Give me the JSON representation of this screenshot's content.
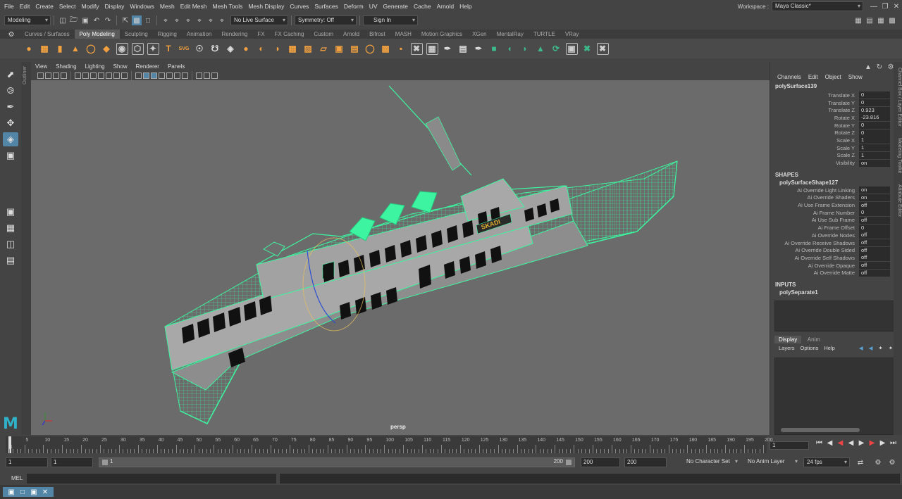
{
  "menubar": {
    "items": [
      "File",
      "Edit",
      "Create",
      "Select",
      "Modify",
      "Display",
      "Windows",
      "Mesh",
      "Edit Mesh",
      "Mesh Tools",
      "Mesh Display",
      "Curves",
      "Surfaces",
      "Deform",
      "UV",
      "Generate",
      "Cache",
      "Arnold",
      "Help"
    ],
    "workspace_label": "Workspace :",
    "workspace_value": "Maya Classic*"
  },
  "statusline": {
    "menuset": "Modeling",
    "live_surface": "No Live Surface",
    "symmetry": "Symmetry: Off",
    "sign_in": "Sign In"
  },
  "shelf": {
    "tabs": [
      "Curves / Surfaces",
      "Poly Modeling",
      "Sculpting",
      "Rigging",
      "Animation",
      "Rendering",
      "FX",
      "FX Caching",
      "Custom",
      "Arnold",
      "Bifrost",
      "MASH",
      "Motion Graphics",
      "XGen",
      "MentalRay",
      "TURTLE",
      "VRay"
    ],
    "active_tab": "Poly Modeling"
  },
  "sidebar_labels": {
    "outliner": "Outliner",
    "channel_box": "Channel Box / Layer Editor",
    "modeling_toolkit": "Modeling Toolkit",
    "attribute_editor": "Attribute Editor"
  },
  "viewport": {
    "menus": [
      "View",
      "Shading",
      "Lighting",
      "Show",
      "Renderer",
      "Panels"
    ],
    "camera_label": "persp",
    "logo_text": "M",
    "boat_name": "SKADI"
  },
  "channel_box": {
    "menus": [
      "Channels",
      "Edit",
      "Object",
      "Show"
    ],
    "object_name": "polySurface139",
    "attributes": [
      {
        "name": "Translate X",
        "value": "0"
      },
      {
        "name": "Translate Y",
        "value": "0"
      },
      {
        "name": "Translate Z",
        "value": "0.923"
      },
      {
        "name": "Rotate X",
        "value": "-23.816"
      },
      {
        "name": "Rotate Y",
        "value": "0"
      },
      {
        "name": "Rotate Z",
        "value": "0"
      },
      {
        "name": "Scale X",
        "value": "1"
      },
      {
        "name": "Scale Y",
        "value": "1"
      },
      {
        "name": "Scale Z",
        "value": "1"
      },
      {
        "name": "Visibility",
        "value": "on"
      }
    ],
    "shapes_header": "SHAPES",
    "shape_name": "polySurfaceShape127",
    "shape_attributes": [
      {
        "name": "Ai Override Light Linking",
        "value": "on"
      },
      {
        "name": "Ai Override Shaders",
        "value": "on"
      },
      {
        "name": "Ai Use Frame Extension",
        "value": "off"
      },
      {
        "name": "Ai Frame Number",
        "value": "0"
      },
      {
        "name": "Ai Use Sub Frame",
        "value": "off"
      },
      {
        "name": "Ai Frame Offset",
        "value": "0"
      },
      {
        "name": "Ai Override Nodes",
        "value": "off"
      },
      {
        "name": "Ai Override Receive Shadows",
        "value": "off"
      },
      {
        "name": "Ai Override Double Sided",
        "value": "off"
      },
      {
        "name": "Ai Override Self Shadows",
        "value": "off"
      },
      {
        "name": "Ai Override Opaque",
        "value": "off"
      },
      {
        "name": "Ai Override Matte",
        "value": "off"
      }
    ],
    "inputs_header": "INPUTS",
    "input_name": "polySeparate1"
  },
  "layer_editor": {
    "tabs": [
      "Display",
      "Anim"
    ],
    "active_tab": "Display",
    "menus": [
      "Layers",
      "Options",
      "Help"
    ]
  },
  "timeline": {
    "ticks": [
      "5",
      "10",
      "15",
      "20",
      "25",
      "30",
      "35",
      "40",
      "45",
      "50",
      "55",
      "60",
      "65",
      "70",
      "75",
      "80",
      "85",
      "90",
      "95",
      "100",
      "105",
      "110",
      "115",
      "120",
      "125",
      "130",
      "135",
      "140",
      "145",
      "150",
      "155",
      "160",
      "165",
      "170",
      "175",
      "180",
      "185",
      "190",
      "195",
      "200"
    ],
    "start_tick": "1",
    "current_frame": "1"
  },
  "range": {
    "start": "1",
    "playback_start": "1",
    "range_start_label": "1",
    "range_end_label": "200",
    "playback_end": "200",
    "end": "200",
    "character_set": "No Character Set",
    "anim_layer": "No Anim Layer",
    "fps": "24 fps"
  },
  "command_line": {
    "language": "MEL"
  },
  "colors": {
    "wire": "#3df5a0",
    "viewport_bg": "#6b6b6b",
    "hull": "#9c9c9c"
  }
}
